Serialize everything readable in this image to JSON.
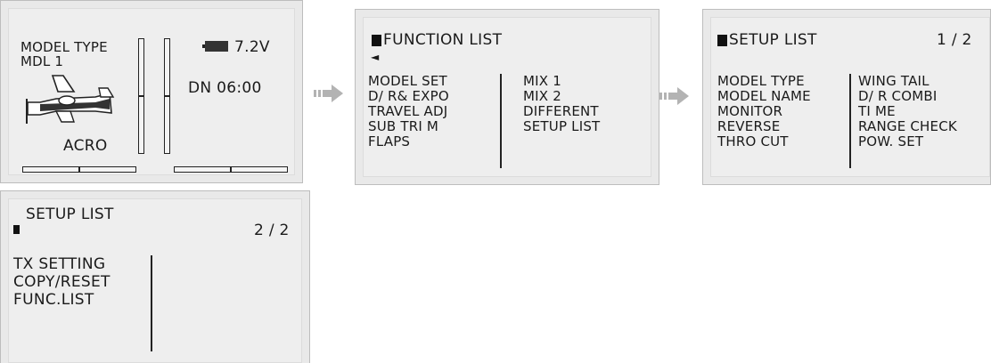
{
  "home": {
    "model_type_label": "MODEL TYPE",
    "model_name": "MDL 1",
    "voltage": "7.2V",
    "timer": "DN 06:00",
    "aircraft_type": "ACRO",
    "trims": {
      "left_vertical": 0.5,
      "right_vertical": 0.5,
      "left_horizontal": 0.5,
      "right_horizontal": 0.5
    }
  },
  "function_list": {
    "title": "FUNCTION LIST",
    "back_glyph": "◄",
    "left_items": [
      "MODEL SET",
      "D/ R& EXPO",
      "TRAVEL ADJ",
      "SUB TRI M",
      "FLAPS"
    ],
    "right_items": [
      "MIX 1",
      "MIX 2",
      "DIFFERENT",
      "SETUP LIST"
    ]
  },
  "setup_list_1": {
    "title": "SETUP  LIST",
    "page": "1 / 2",
    "left_items": [
      "MODEL TYPE",
      "MODEL NAME",
      "MONITOR",
      "REVERSE",
      "THRO CUT"
    ],
    "right_items": [
      "WING TAIL",
      "D/ R COMBI",
      "TI ME",
      "RANGE CHECK",
      "POW. SET"
    ]
  },
  "setup_list_2": {
    "title": "SETUP  LIST",
    "page": "2 / 2",
    "items": [
      "TX SETTING",
      "COPY/RESET",
      "FUNC.LIST"
    ]
  },
  "colors": {
    "panel_bg": "#eeeeee",
    "frame": "#bdbdbd",
    "text": "#1a1a1a",
    "arrow": "#b3b3b3"
  },
  "icons": [
    "battery-icon",
    "airplane-icon",
    "cursor-square-icon",
    "right-arrow-icon",
    "back-arrow-icon"
  ]
}
